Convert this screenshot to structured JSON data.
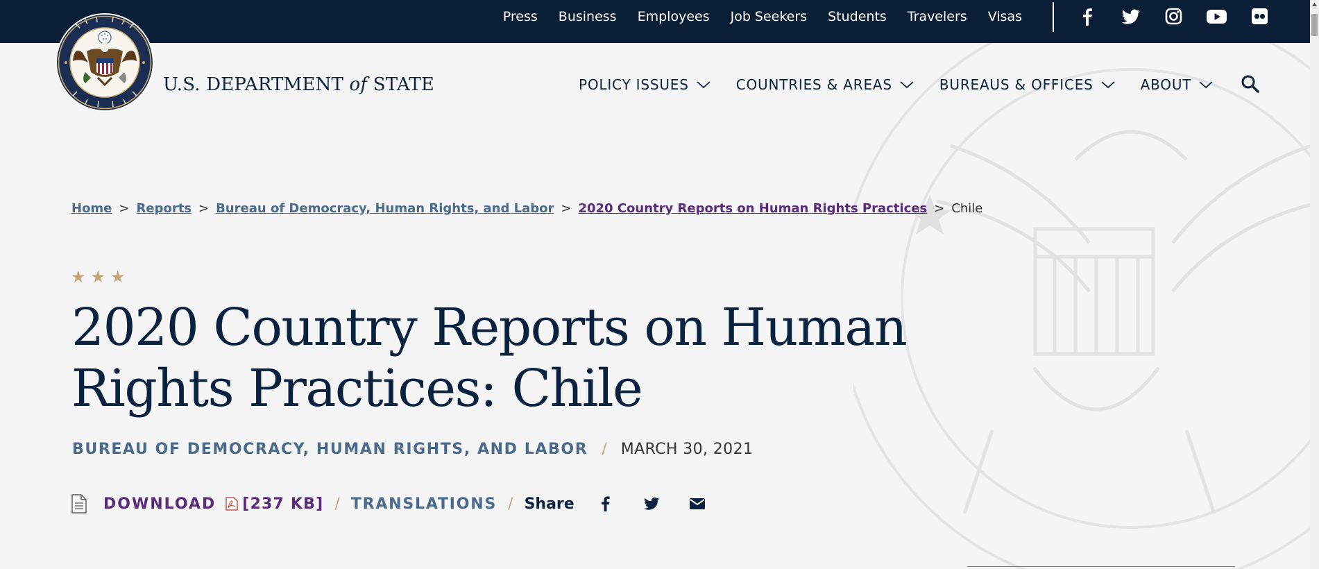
{
  "topbar": {
    "links": [
      "Press",
      "Business",
      "Employees",
      "Job Seekers",
      "Students",
      "Travelers",
      "Visas"
    ],
    "social_icons": [
      "facebook-icon",
      "twitter-icon",
      "instagram-icon",
      "youtube-icon",
      "flickr-icon"
    ]
  },
  "header": {
    "site_title_main": "U.S. DEPARTMENT",
    "site_title_of": "of",
    "site_title_end": "STATE",
    "nav": [
      "POLICY ISSUES",
      "COUNTRIES & AREAS",
      "BUREAUS & OFFICES",
      "ABOUT"
    ]
  },
  "breadcrumb": {
    "items": [
      "Home",
      "Reports",
      "Bureau of Democracy, Human Rights, and Labor",
      "2020 Country Reports on Human Rights Practices"
    ],
    "current": "Chile",
    "separator": ">"
  },
  "article": {
    "stars": "★★★",
    "title": "2020 Country Reports on Human Rights Practices: Chile",
    "bureau": "BUREAU OF DEMOCRACY, HUMAN RIGHTS, AND LABOR",
    "date": "MARCH 30, 2021",
    "slash": "/",
    "download_label": "DOWNLOAD",
    "file_size": "[237 KB]",
    "translations_label": "TRANSLATIONS",
    "share_label": "Share"
  },
  "colors": {
    "navy": "#0a2240",
    "topbar": "#0a1f35",
    "link_blue": "#4a6a8c",
    "visited_purple": "#5a2a7a",
    "gold": "#c4a57a"
  }
}
